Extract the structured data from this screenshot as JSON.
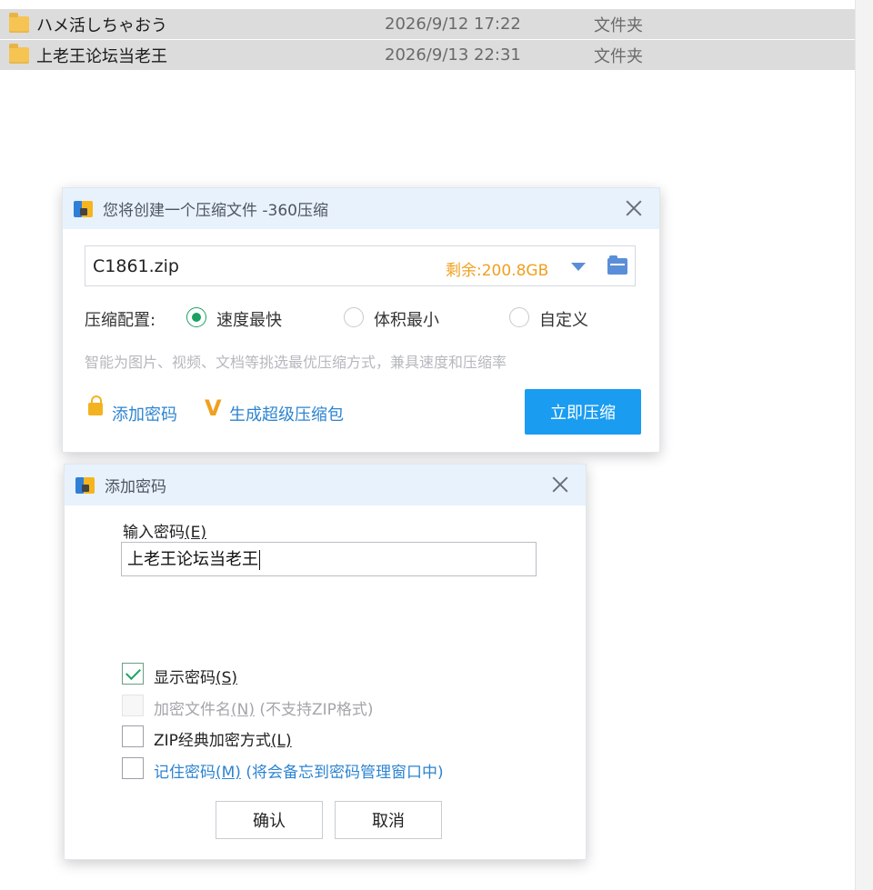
{
  "files": [
    {
      "name": "ハメ活しちゃおう",
      "date": "2026/9/12 17:22",
      "type": "文件夹"
    },
    {
      "name": "上老王论坛当老王",
      "date": "2026/9/13 22:31",
      "type": "文件夹"
    }
  ],
  "compress_dialog": {
    "title": "您将创建一个压缩文件 -360压缩",
    "filename": "C1861.zip",
    "remaining": "剩余:200.8GB",
    "config_label": "压缩配置:",
    "options": [
      "速度最快",
      "体积最小",
      "自定义"
    ],
    "selected_option": "速度最快",
    "hint": "智能为图片、视频、文档等挑选最优压缩方式，兼具速度和压缩率",
    "add_password_link": "添加密码",
    "super_pack_link": "生成超级压缩包",
    "compress_button": "立即压缩"
  },
  "password_dialog": {
    "title": "添加密码",
    "input_label": "输入密码",
    "input_label_key": "(E)",
    "password_value": "上老王论坛当老王",
    "checkboxes": [
      {
        "label": "显示密码",
        "key": "(S)",
        "suffix": "",
        "checked": true,
        "disabled": false
      },
      {
        "label": "加密文件名",
        "key": "(N)",
        "suffix": " (不支持ZIP格式)",
        "checked": false,
        "disabled": true
      },
      {
        "label": "ZIP经典加密方式",
        "key": "(L)",
        "suffix": "",
        "checked": false,
        "disabled": false
      },
      {
        "label": "记住密码",
        "key": "(M)",
        "suffix": " (将会备忘到密码管理窗口中)",
        "checked": false,
        "disabled": false
      }
    ],
    "ok_button": "确认",
    "cancel_button": "取消"
  },
  "colors": {
    "accent_blue": "#1a9cf1",
    "link_blue": "#2d84d0",
    "remaining_orange": "#f0a020",
    "radio_green": "#1aa260",
    "title_bar": "#e8f2fc",
    "selection_gray": "#dcdcdc"
  },
  "icons": [
    "folder-icon",
    "archive-app-icon",
    "close-icon",
    "dropdown-arrow-icon",
    "browse-folder-icon",
    "lock-icon",
    "v-super-icon",
    "checkmark-icon"
  ]
}
